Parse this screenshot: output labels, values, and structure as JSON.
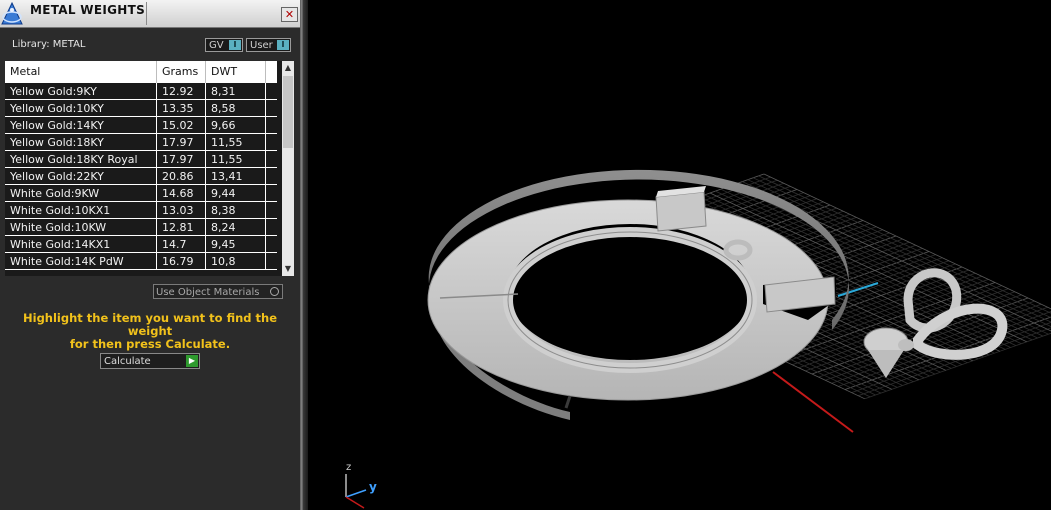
{
  "window": {
    "title": "METAL WEIGHTS",
    "close_glyph": "✕"
  },
  "library": {
    "label": "Library: METAL",
    "toggles": [
      {
        "label": "GV",
        "checked": true
      },
      {
        "label": "User",
        "checked": true
      }
    ]
  },
  "table": {
    "headers": [
      "Metal",
      "Grams",
      "DWT"
    ],
    "rows": [
      [
        "Yellow Gold:9KY",
        "12.92",
        "8,31"
      ],
      [
        "Yellow Gold:10KY",
        "13.35",
        "8,58"
      ],
      [
        "Yellow Gold:14KY",
        "15.02",
        "9,66"
      ],
      [
        "Yellow Gold:18KY",
        "17.97",
        "11,55"
      ],
      [
        "Yellow Gold:18KY Royal",
        "17.97",
        "11,55"
      ],
      [
        "Yellow Gold:22KY",
        "20.86",
        "13,41"
      ],
      [
        "White Gold:9KW",
        "14.68",
        "9,44"
      ],
      [
        "White Gold:10KX1",
        "13.03",
        "8,38"
      ],
      [
        "White Gold:10KW",
        "12.81",
        "8,24"
      ],
      [
        "White Gold:14KX1",
        "14.7",
        "9,45"
      ],
      [
        "White Gold:14K PdW",
        "16.79",
        "10,8"
      ]
    ]
  },
  "use_object_materials": {
    "label": "Use Object Materials",
    "checked": false
  },
  "hint": {
    "line1": "Highlight the item you want to find the weight",
    "line2": "for then press Calculate."
  },
  "calculate": {
    "label": "Calculate"
  },
  "viewport": {
    "axis_z": "z",
    "axis_y": "y"
  },
  "colors": {
    "panel_bg": "#2b2b2b",
    "hint": "#f2c21b",
    "row_text": "#f2f2f2",
    "accent_toggle": "#5ab0c0",
    "go_green": "#2e9a2e"
  }
}
